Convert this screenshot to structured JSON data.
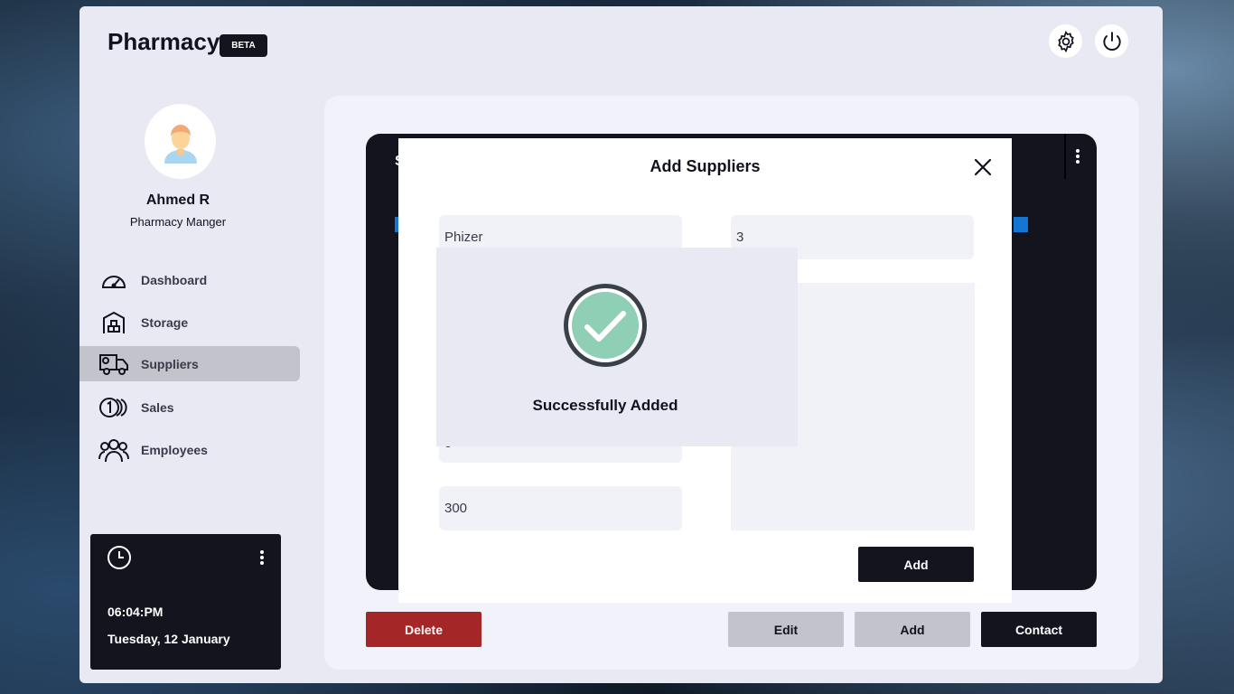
{
  "app": {
    "title": "Pharmacy",
    "badge": "BETA"
  },
  "header": {
    "settings_icon": "gear-icon",
    "power_icon": "power-icon"
  },
  "user": {
    "name": "Ahmed R",
    "role": "Pharmacy Manger"
  },
  "sidebar": {
    "items": [
      {
        "label": "Dashboard",
        "icon": "speedometer-icon",
        "active": false
      },
      {
        "label": "Storage",
        "icon": "warehouse-icon",
        "active": false
      },
      {
        "label": "Suppliers",
        "icon": "truck-icon",
        "active": true
      },
      {
        "label": "Sales",
        "icon": "coins-icon",
        "active": false
      },
      {
        "label": "Employees",
        "icon": "people-icon",
        "active": false
      }
    ]
  },
  "clock": {
    "time": "06:04:PM",
    "date": "Tuesday, 12 January"
  },
  "table": {
    "partial_title": "S"
  },
  "actions": {
    "delete_label": "Delete",
    "edit_label": "Edit",
    "add_label": "Add",
    "contact_label": "Contact"
  },
  "modal": {
    "title": "Add Suppliers",
    "fields": {
      "name_value": "Phizer",
      "number_value": "3",
      "hidden_value": "g",
      "amount_value": "300"
    },
    "add_label": "Add"
  },
  "toast": {
    "message": "Successfully Added"
  },
  "colors": {
    "dark": "#14141f",
    "danger": "#a52626",
    "success": "#8ecfb6",
    "accent_blue": "#1476d2"
  }
}
